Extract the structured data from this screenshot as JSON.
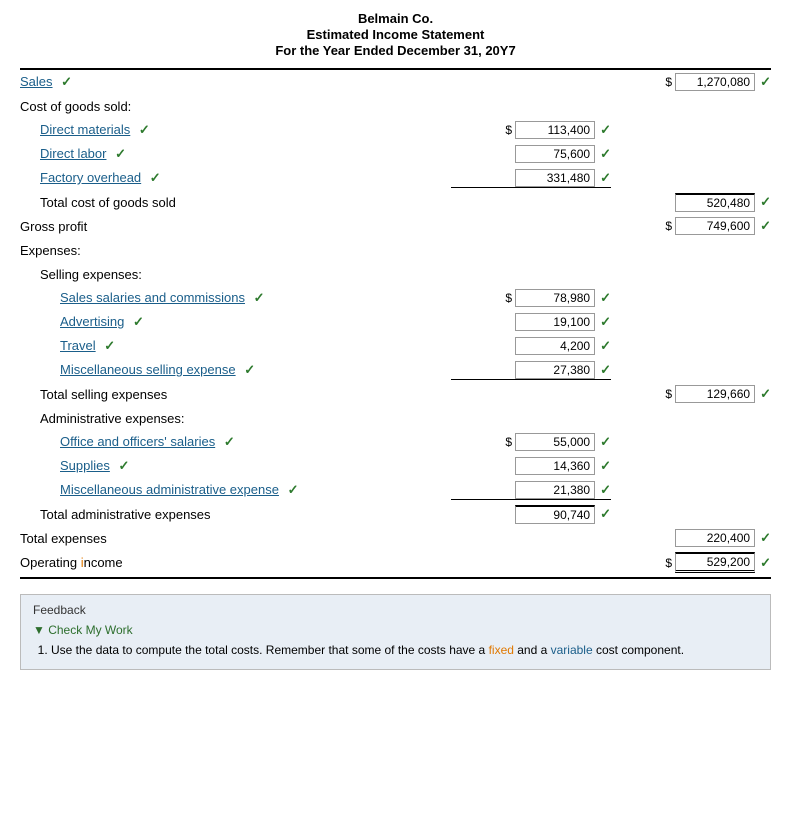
{
  "header": {
    "line1": "Belmain Co.",
    "line2": "Estimated Income Statement",
    "line3": "For the Year Ended December 31, 20Y7"
  },
  "rows": {
    "sales_label": "Sales",
    "sales_value": "1,270,080",
    "cogs_label": "Cost of goods sold:",
    "direct_materials_label": "Direct materials",
    "direct_materials_value": "113,400",
    "direct_labor_label": "Direct labor",
    "direct_labor_value": "75,600",
    "factory_overhead_label": "Factory overhead",
    "factory_overhead_value": "331,480",
    "total_cogs_label": "Total cost of goods sold",
    "total_cogs_value": "520,480",
    "gross_profit_label": "Gross profit",
    "gross_profit_value": "749,600",
    "expenses_label": "Expenses:",
    "selling_label": "Selling expenses:",
    "sales_sal_label": "Sales salaries and commissions",
    "sales_sal_value": "78,980",
    "advertising_label": "Advertising",
    "advertising_value": "19,100",
    "travel_label": "Travel",
    "travel_value": "4,200",
    "misc_selling_label": "Miscellaneous selling expense",
    "misc_selling_value": "27,380",
    "total_selling_label": "Total selling expenses",
    "total_selling_value": "129,660",
    "admin_label": "Administrative expenses:",
    "office_sal_label": "Office and officers' salaries",
    "office_sal_value": "55,000",
    "supplies_label": "Supplies",
    "supplies_value": "14,360",
    "misc_admin_label": "Miscellaneous administrative expense",
    "misc_admin_value": "21,380",
    "total_admin_label": "Total administrative expenses",
    "total_admin_value": "90,740",
    "total_expenses_label": "Total expenses",
    "total_expenses_value": "220,400",
    "operating_income_label": "Operating income",
    "operating_income_value": "529,200"
  },
  "feedback": {
    "title": "Feedback",
    "check_work": "Check My Work",
    "note1": "Use the data to compute the total costs. Remember that some of the costs have a fixed and a variable cost component."
  },
  "check_symbol": "✓"
}
